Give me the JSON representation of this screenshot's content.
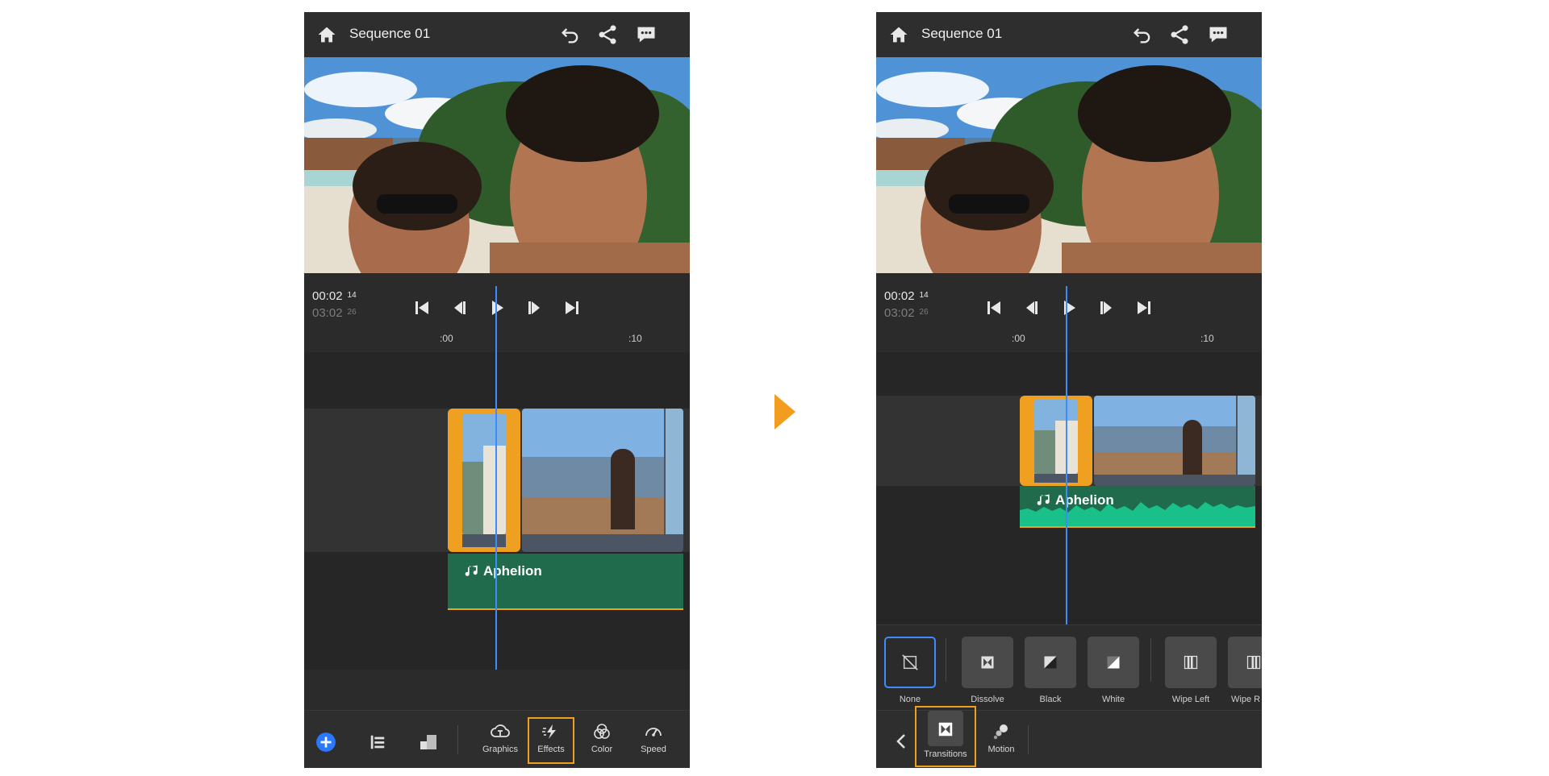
{
  "sequence_title": "Sequence 01",
  "timecode": {
    "current": "00:02",
    "current_frames": "14",
    "total": "03:02",
    "total_frames": "26"
  },
  "ruler": {
    "mark_start": ":00",
    "mark_end": ":10"
  },
  "audio_clip": {
    "title": "Aphelion"
  },
  "left_toolbar": [
    {
      "label": "Graphics",
      "icon": "graphics-icon"
    },
    {
      "label": "Effects",
      "icon": "effects-icon",
      "selected": true
    },
    {
      "label": "Color",
      "icon": "color-icon"
    },
    {
      "label": "Speed",
      "icon": "speed-icon"
    }
  ],
  "transitions": [
    {
      "label": "None",
      "icon": "none-transition-icon",
      "selected": true
    },
    {
      "label": "Dissolve",
      "icon": "dissolve-icon"
    },
    {
      "label": "Black",
      "icon": "black-transition-icon"
    },
    {
      "label": "White",
      "icon": "white-transition-icon"
    },
    {
      "label": "Wipe Left",
      "icon": "wipe-left-icon"
    },
    {
      "label": "Wipe R",
      "icon": "wipe-right-icon"
    }
  ],
  "effects_tabs": [
    {
      "label": "Transitions",
      "icon": "transitions-icon",
      "selected": true
    },
    {
      "label": "Motion",
      "icon": "motion-icon"
    }
  ],
  "colors": {
    "accent_orange": "#f0a020",
    "playhead_blue": "#3d8bff",
    "audio_green": "#1f6b4c",
    "audio_waveform": "#19c08a"
  }
}
